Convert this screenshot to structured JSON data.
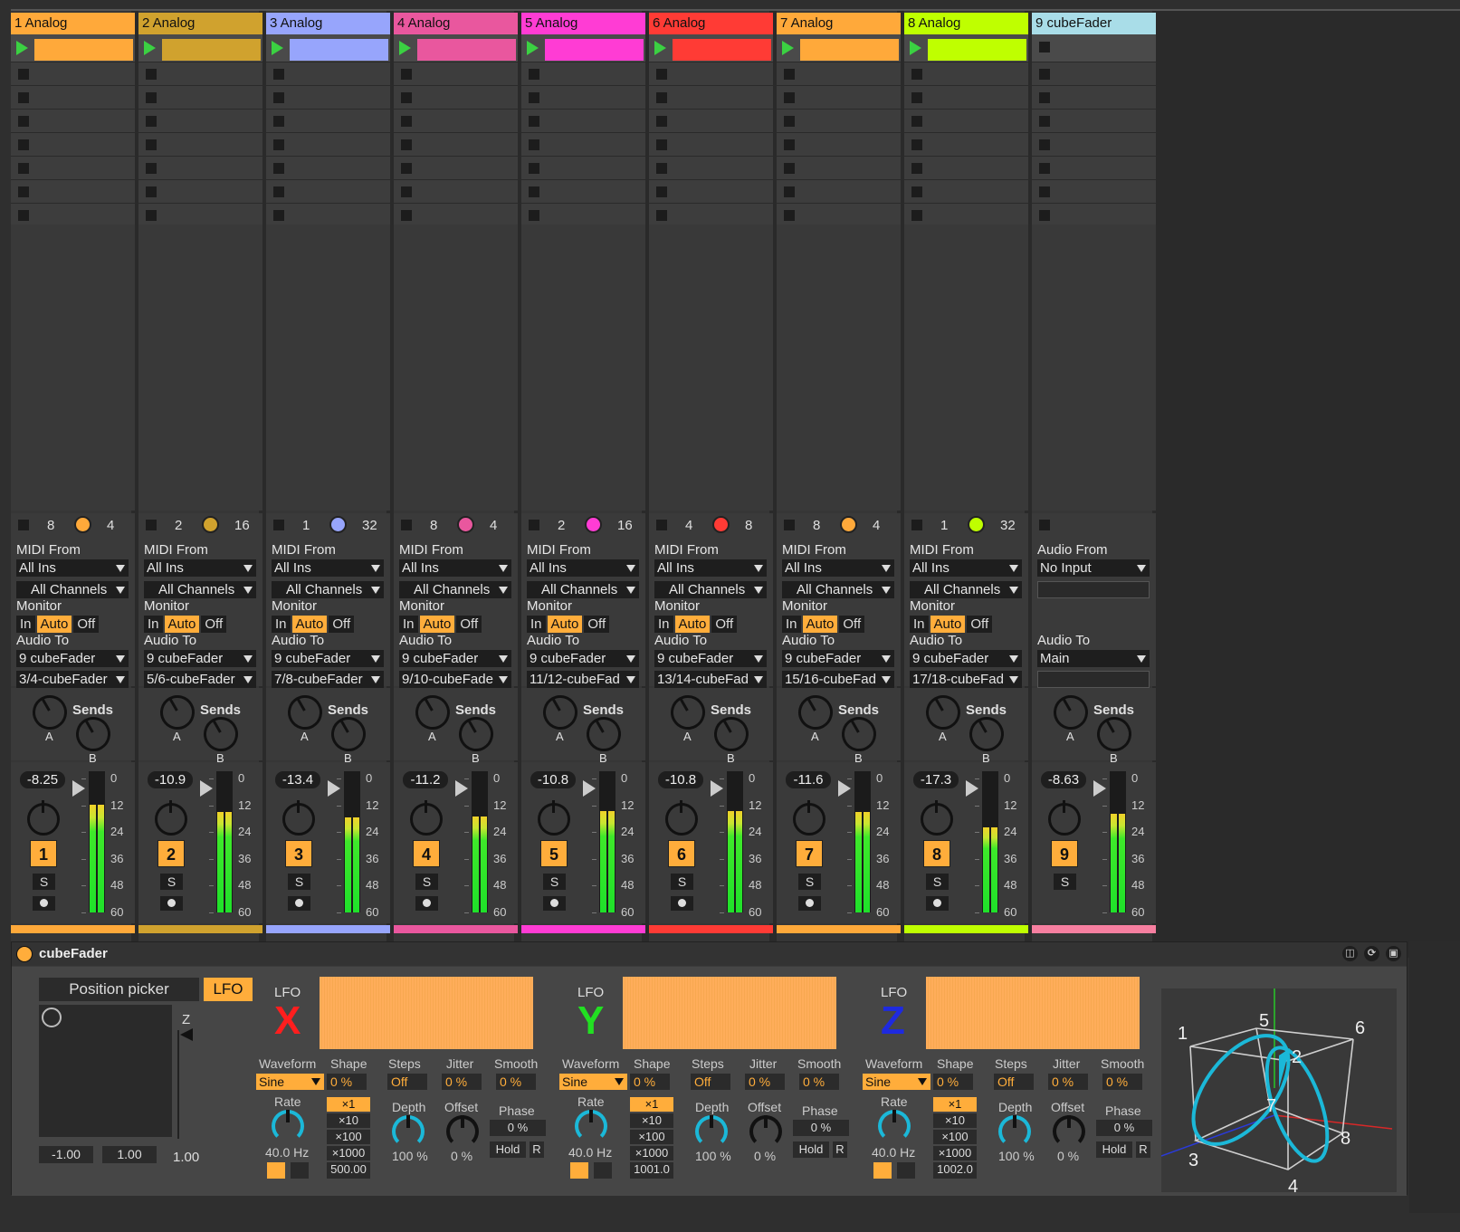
{
  "tracks": [
    {
      "name": "1 Analog",
      "color": "#ffa93a",
      "n1": "8",
      "n2": "4",
      "input_label": "MIDI From",
      "input": "All Ins",
      "channel": "All Channels",
      "monitor_label": "Monitor",
      "mon": [
        "In",
        "Auto",
        "Off"
      ],
      "out_label": "Audio To",
      "out": "9 cubeFader",
      "out2": "3/4-cubeFader",
      "sends_label": "Sends",
      "send_a": "A",
      "send_b": "B",
      "volume": "-8.25",
      "number": "1",
      "solo": "S",
      "meter": [
        0.76,
        0.76
      ]
    },
    {
      "name": "2 Analog",
      "color": "#d0a22e",
      "n1": "2",
      "n2": "16",
      "input_label": "MIDI From",
      "input": "All Ins",
      "channel": "All Channels",
      "monitor_label": "Monitor",
      "mon": [
        "In",
        "Auto",
        "Off"
      ],
      "out_label": "Audio To",
      "out": "9 cubeFader",
      "out2": "5/6-cubeFader",
      "sends_label": "Sends",
      "send_a": "A",
      "send_b": "B",
      "volume": "-10.9",
      "number": "2",
      "solo": "S",
      "meter": [
        0.71,
        0.71
      ]
    },
    {
      "name": "3 Analog",
      "color": "#97a5fc",
      "n1": "1",
      "n2": "32",
      "input_label": "MIDI From",
      "input": "All Ins",
      "channel": "All Channels",
      "monitor_label": "Monitor",
      "mon": [
        "In",
        "Auto",
        "Off"
      ],
      "out_label": "Audio To",
      "out": "9 cubeFader",
      "out2": "7/8-cubeFader",
      "sends_label": "Sends",
      "send_a": "A",
      "send_b": "B",
      "volume": "-13.4",
      "number": "3",
      "solo": "S",
      "meter": [
        0.67,
        0.67
      ]
    },
    {
      "name": "4 Analog",
      "color": "#e9579e",
      "n1": "8",
      "n2": "4",
      "input_label": "MIDI From",
      "input": "All Ins",
      "channel": "All Channels",
      "monitor_label": "Monitor",
      "mon": [
        "In",
        "Auto",
        "Off"
      ],
      "out_label": "Audio To",
      "out": "9 cubeFader",
      "out2": "9/10-cubeFade",
      "sends_label": "Sends",
      "send_a": "A",
      "send_b": "B",
      "volume": "-11.2",
      "number": "4",
      "solo": "S",
      "meter": [
        0.68,
        0.68
      ]
    },
    {
      "name": "5 Analog",
      "color": "#ff3cd4",
      "n1": "2",
      "n2": "16",
      "input_label": "MIDI From",
      "input": "All Ins",
      "channel": "All Channels",
      "monitor_label": "Monitor",
      "mon": [
        "In",
        "Auto",
        "Off"
      ],
      "out_label": "Audio To",
      "out": "9 cubeFader",
      "out2": "11/12-cubeFad",
      "sends_label": "Sends",
      "send_a": "A",
      "send_b": "B",
      "volume": "-10.8",
      "number": "5",
      "solo": "S",
      "meter": [
        0.72,
        0.72
      ]
    },
    {
      "name": "6 Analog",
      "color": "#ff3b35",
      "n1": "4",
      "n2": "8",
      "input_label": "MIDI From",
      "input": "All Ins",
      "channel": "All Channels",
      "monitor_label": "Monitor",
      "mon": [
        "In",
        "Auto",
        "Off"
      ],
      "out_label": "Audio To",
      "out": "9 cubeFader",
      "out2": "13/14-cubeFad",
      "sends_label": "Sends",
      "send_a": "A",
      "send_b": "B",
      "volume": "-10.8",
      "number": "6",
      "solo": "S",
      "meter": [
        0.72,
        0.72
      ]
    },
    {
      "name": "7 Analog",
      "color": "#ffa93a",
      "n1": "8",
      "n2": "4",
      "input_label": "MIDI From",
      "input": "All Ins",
      "channel": "All Channels",
      "monitor_label": "Monitor",
      "mon": [
        "In",
        "Auto",
        "Off"
      ],
      "out_label": "Audio To",
      "out": "9 cubeFader",
      "out2": "15/16-cubeFad",
      "sends_label": "Sends",
      "send_a": "A",
      "send_b": "B",
      "volume": "-11.6",
      "number": "7",
      "solo": "S",
      "meter": [
        0.71,
        0.71
      ]
    },
    {
      "name": "8 Analog",
      "color": "#bfff00",
      "n1": "1",
      "n2": "32",
      "input_label": "MIDI From",
      "input": "All Ins",
      "channel": "All Channels",
      "monitor_label": "Monitor",
      "mon": [
        "In",
        "Auto",
        "Off"
      ],
      "out_label": "Audio To",
      "out": "9 cubeFader",
      "out2": "17/18-cubeFad",
      "sends_label": "Sends",
      "send_a": "A",
      "send_b": "B",
      "volume": "-17.3",
      "number": "8",
      "solo": "S",
      "meter": [
        0.6,
        0.6
      ]
    }
  ],
  "master": {
    "name": "9 cubeFader",
    "color": "#a9dde8",
    "input_label": "Audio From",
    "input": "No Input",
    "out_label": "Audio To",
    "out": "Main",
    "sends_label": "Sends",
    "send_a": "A",
    "send_b": "B",
    "volume": "-8.63",
    "number": "9",
    "solo": "S",
    "strip_color": "#f77fa0",
    "meter": [
      0.7,
      0.7
    ]
  },
  "meter_scale": [
    "0",
    "12",
    "24",
    "36",
    "48",
    "60"
  ],
  "device": {
    "title": "cubeFader",
    "position_picker": "Position picker",
    "lfo_button": "LFO",
    "pad_min": "-1.00",
    "pad_max": "1.00",
    "z_label": "Z",
    "z_value": "1.00",
    "lfos": [
      {
        "lfo_label": "LFO",
        "axis": "X",
        "axis_color": "#ff1e1e",
        "waveform": "Sine",
        "shape": "0 %",
        "steps": "Off",
        "jitter": "0 %",
        "smooth": "0 %",
        "rate": "40.0 Hz",
        "depth": "100 %",
        "offset": "0 %",
        "phase": "0 %",
        "hold": "Hold",
        "r": "R",
        "mults": [
          "×1",
          "×10",
          "×100",
          "×1000"
        ],
        "freq": "500.00"
      },
      {
        "lfo_label": "LFO",
        "axis": "Y",
        "axis_color": "#22e022",
        "waveform": "Sine",
        "shape": "0 %",
        "steps": "Off",
        "jitter": "0 %",
        "smooth": "0 %",
        "rate": "40.0 Hz",
        "depth": "100 %",
        "offset": "0 %",
        "phase": "0 %",
        "hold": "Hold",
        "r": "R",
        "mults": [
          "×1",
          "×10",
          "×100",
          "×1000"
        ],
        "freq": "1001.0"
      },
      {
        "lfo_label": "LFO",
        "axis": "Z",
        "axis_color": "#1e2ae0",
        "waveform": "Sine",
        "shape": "0 %",
        "steps": "Off",
        "jitter": "0 %",
        "smooth": "0 %",
        "rate": "40.0 Hz",
        "depth": "100 %",
        "offset": "0 %",
        "phase": "0 %",
        "hold": "Hold",
        "r": "R",
        "mults": [
          "×1",
          "×10",
          "×100",
          "×1000"
        ],
        "freq": "1002.0"
      }
    ],
    "param_labels": {
      "waveform": "Waveform",
      "shape": "Shape",
      "steps": "Steps",
      "jitter": "Jitter",
      "smooth": "Smooth",
      "rate": "Rate",
      "depth": "Depth",
      "offset": "Offset",
      "phase": "Phase"
    },
    "cube_labels": [
      "1",
      "2",
      "3",
      "4",
      "5",
      "6",
      "7",
      "8"
    ]
  }
}
